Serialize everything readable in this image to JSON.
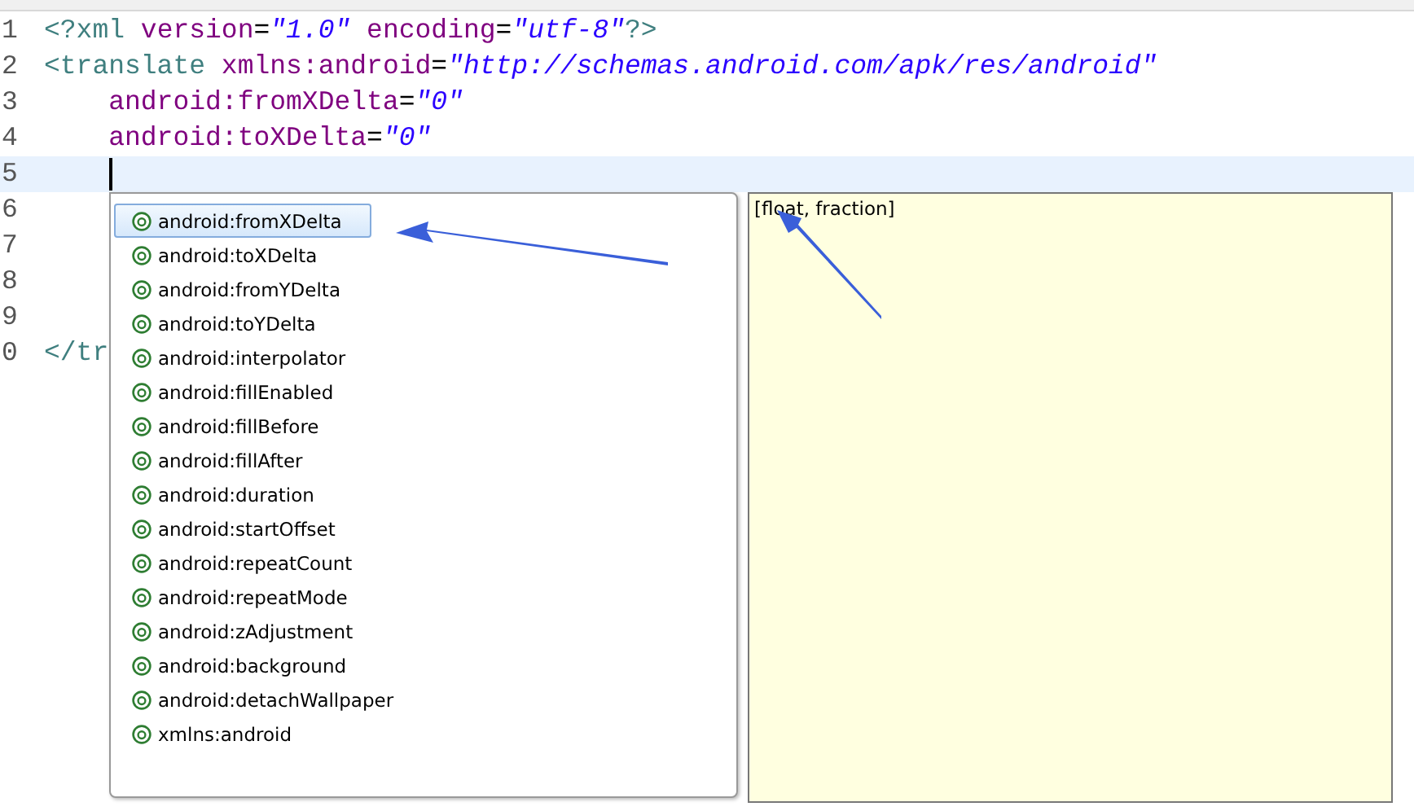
{
  "editor": {
    "lines": [
      {
        "number": "1",
        "current": false,
        "tokens": [
          {
            "text": "<?xml",
            "kind": "tag"
          },
          {
            "text": " version",
            "kind": "attr"
          },
          {
            "text": "=",
            "kind": "punct"
          },
          {
            "text": "\"1.0\"",
            "kind": "value"
          },
          {
            "text": " encoding",
            "kind": "attr"
          },
          {
            "text": "=",
            "kind": "punct"
          },
          {
            "text": "\"utf-8\"",
            "kind": "value"
          },
          {
            "text": "?>",
            "kind": "tag"
          }
        ]
      },
      {
        "number": "2",
        "current": false,
        "tokens": [
          {
            "text": "<translate",
            "kind": "tag"
          },
          {
            "text": " xmlns:android",
            "kind": "attr"
          },
          {
            "text": "=",
            "kind": "punct"
          },
          {
            "text": "\"http://schemas.android.com/apk/res/android\"",
            "kind": "value"
          }
        ]
      },
      {
        "number": "3",
        "current": false,
        "tokens": [
          {
            "text": "    android:fromXDelta",
            "kind": "attr"
          },
          {
            "text": "=",
            "kind": "punct"
          },
          {
            "text": "\"0\"",
            "kind": "value"
          }
        ]
      },
      {
        "number": "4",
        "current": false,
        "tokens": [
          {
            "text": "    android:toXDelta",
            "kind": "attr"
          },
          {
            "text": "=",
            "kind": "punct"
          },
          {
            "text": "\"0\"",
            "kind": "value"
          }
        ]
      },
      {
        "number": "5",
        "current": true
      },
      {
        "number": "6",
        "current": false
      },
      {
        "number": "7",
        "current": false
      },
      {
        "number": "8",
        "current": false
      },
      {
        "number": "9",
        "current": false
      },
      {
        "number": "0",
        "current": false,
        "tokens": [
          {
            "text": "</tr",
            "kind": "tag"
          }
        ]
      }
    ]
  },
  "completion": {
    "items": [
      {
        "label": "android:fromXDelta",
        "selected": true
      },
      {
        "label": "android:toXDelta",
        "selected": false
      },
      {
        "label": "android:fromYDelta",
        "selected": false
      },
      {
        "label": "android:toYDelta",
        "selected": false
      },
      {
        "label": "android:interpolator",
        "selected": false
      },
      {
        "label": "android:fillEnabled",
        "selected": false
      },
      {
        "label": "android:fillBefore",
        "selected": false
      },
      {
        "label": "android:fillAfter",
        "selected": false
      },
      {
        "label": "android:duration",
        "selected": false
      },
      {
        "label": "android:startOffset",
        "selected": false
      },
      {
        "label": "android:repeatCount",
        "selected": false
      },
      {
        "label": "android:repeatMode",
        "selected": false
      },
      {
        "label": "android:zAdjustment",
        "selected": false
      },
      {
        "label": "android:background",
        "selected": false
      },
      {
        "label": "android:detachWallpaper",
        "selected": false
      },
      {
        "label": "xmlns:android",
        "selected": false
      }
    ],
    "details": {
      "text": "[float, fraction]"
    }
  }
}
